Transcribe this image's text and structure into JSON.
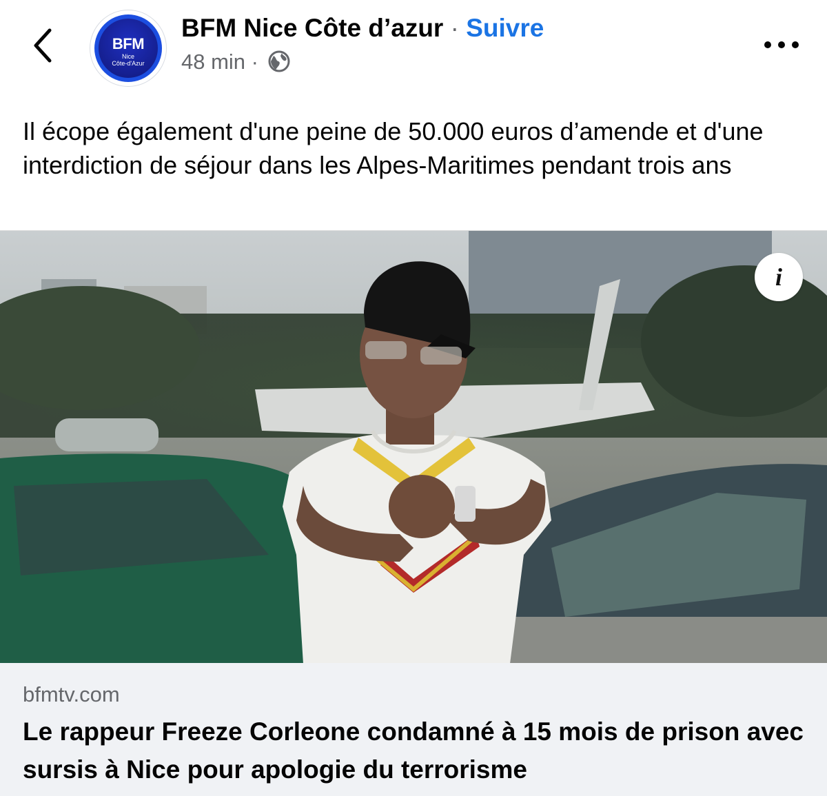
{
  "header": {
    "back_icon": "chevron-left-icon",
    "avatar": {
      "logo_text": "BFM",
      "logo_sub_line1": "Nice",
      "logo_sub_line2": "Côte-d'Azur",
      "ring_color": "#1c4ee0",
      "fill_color": "#151f8f"
    },
    "page_name": "BFM Nice Côte d’azur",
    "separator": "·",
    "follow_label": "Suivre",
    "timestamp": "48 min",
    "meta_separator": "·",
    "audience_icon": "globe-icon",
    "more_icon": "more-horizontal-icon"
  },
  "post": {
    "text": "Il écope également d'une peine de 50.000 euros d’amende et d'une interdiction de séjour dans les Alpes-Maritimes pendant trois ans"
  },
  "media": {
    "info_icon": "info-icon",
    "info_glyph": "i"
  },
  "link": {
    "domain": "bfmtv.com",
    "headline": "Le rappeur Freeze Corleone condamné à 15 mois de prison avec sursis à Nice pour apologie du terrorisme"
  },
  "colors": {
    "accent": "#1b74e4",
    "secondary_text": "#65676b",
    "link_background": "#f0f2f5"
  }
}
